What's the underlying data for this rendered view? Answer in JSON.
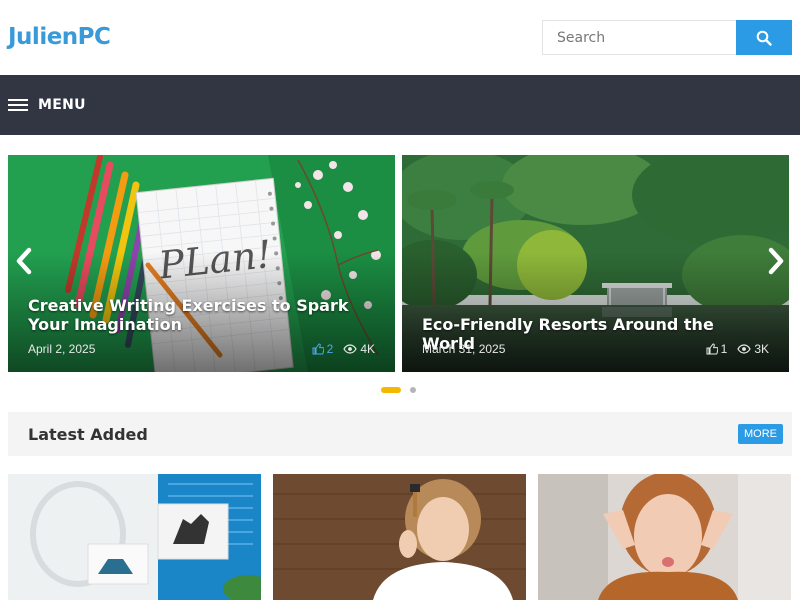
{
  "site": {
    "logo": "JulienPC"
  },
  "search": {
    "placeholder": "Search",
    "icon": "search-icon"
  },
  "nav": {
    "menu_label": "MENU",
    "menu_icon": "hamburger-icon"
  },
  "slider": {
    "slides": [
      {
        "title": "Creative Writing Exercises to Spark Your Imagination",
        "date": "April 2, 2025",
        "likes": "2",
        "views": "4K",
        "image_text": "PLan!"
      },
      {
        "title": "Eco-Friendly Resorts Around the World",
        "date": "March 31, 2025",
        "likes": "1",
        "views": "3K"
      }
    ],
    "active_dot": 1,
    "dot_count": 2
  },
  "latest": {
    "title": "Latest Added",
    "more_label": "MORE"
  },
  "colors": {
    "brand": "#3a9ad9",
    "accent": "#2b9be6",
    "nav_bg": "#323643",
    "dot_active": "#f5b800"
  }
}
